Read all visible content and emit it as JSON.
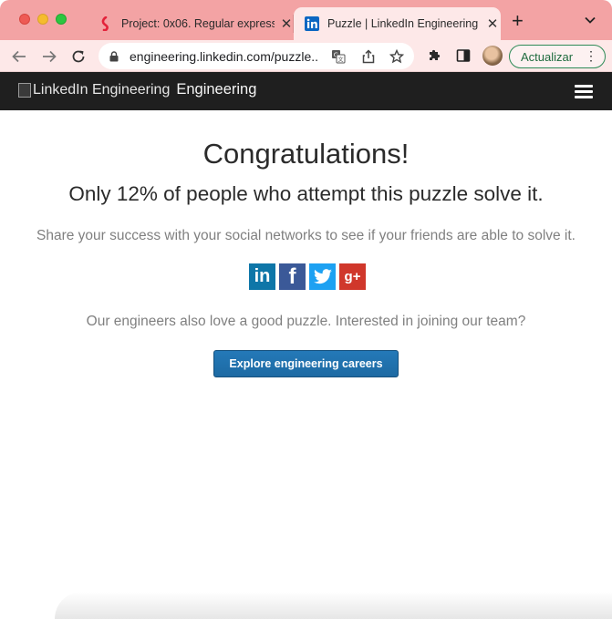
{
  "browser": {
    "tabs": [
      {
        "title": "Project: 0x06. Regular expressi",
        "favicon": "project-favicon-icon",
        "active": false
      },
      {
        "title": "Puzzle | LinkedIn Engineering",
        "favicon": "linkedin-favicon-icon",
        "active": true
      }
    ],
    "close_glyph": "✕",
    "new_tab_glyph": "+",
    "tab_menu_glyph": "⌄",
    "url": "engineering.linkedin.com/puzzle...",
    "update_label": "Actualizar",
    "menu_glyph": "⋮",
    "tab_strip_color": "#f3a3a4"
  },
  "site": {
    "logo_alt": "LinkedIn Engineering",
    "brand_word": "Engineering",
    "header_color": "#1f1f1f"
  },
  "main": {
    "heading": "Congratulations!",
    "stat": "Only 12% of people who attempt this puzzle solve it.",
    "share_text": "Share your success with your social networks to see if your friends are able to solve it.",
    "social": {
      "linkedin": "in",
      "facebook": "f",
      "google_plus": "g+"
    },
    "engineers_text": "Our engineers also love a good puzzle. Interested in joining our team?",
    "careers_button": "Explore engineering careers",
    "button_color": "#1d6aa3"
  }
}
